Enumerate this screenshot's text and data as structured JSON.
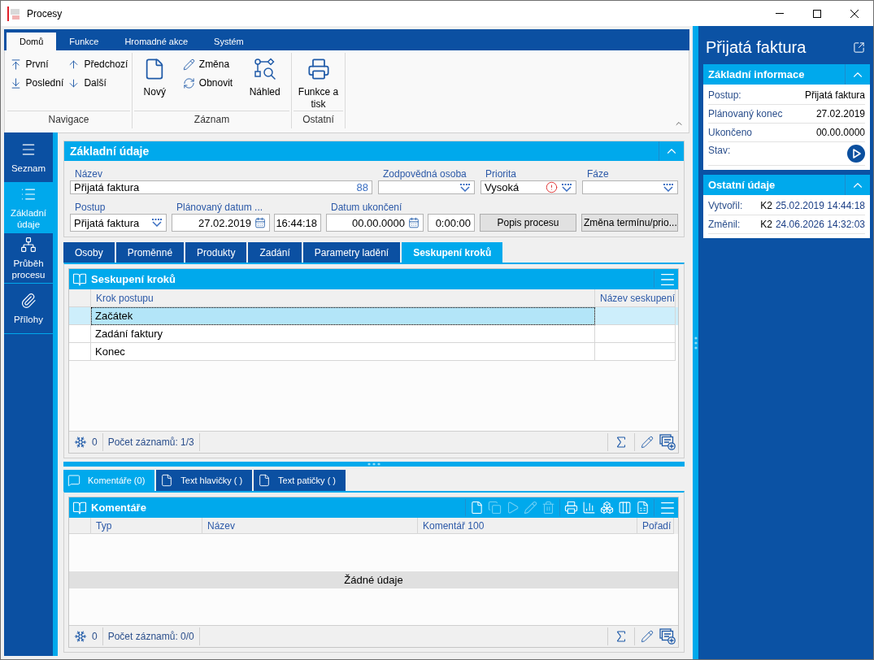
{
  "window": {
    "title": "Procesy"
  },
  "ribbon": {
    "tabs": [
      {
        "label": "Domů",
        "selected": true
      },
      {
        "label": "Funkce",
        "selected": false
      },
      {
        "label": "Hromadné akce",
        "selected": false
      },
      {
        "label": "Systém",
        "selected": false
      }
    ],
    "groups": [
      {
        "label": "Navigace",
        "items": [
          {
            "label": "První",
            "kind": "small"
          },
          {
            "label": "Poslední",
            "kind": "small"
          },
          {
            "label": "Předchozí",
            "kind": "small"
          },
          {
            "label": "Další",
            "kind": "small"
          }
        ]
      },
      {
        "label": "Záznam",
        "items": [
          {
            "label": "Nový",
            "kind": "large"
          },
          {
            "label": "Změna",
            "kind": "small"
          },
          {
            "label": "Obnovit",
            "kind": "small"
          },
          {
            "label": "Náhled",
            "kind": "large"
          }
        ]
      },
      {
        "label": "Ostatní",
        "items": [
          {
            "label": "Funkce a tisk",
            "kind": "large"
          }
        ]
      }
    ]
  },
  "sidebar": {
    "items": [
      {
        "label": "Seznam",
        "selected": false
      },
      {
        "label": "Základní údaje",
        "selected": true
      },
      {
        "label": "Průběh procesu",
        "selected": false
      },
      {
        "label": "Přílohy",
        "selected": false
      }
    ]
  },
  "form": {
    "title": "Základní údaje",
    "expanded": true,
    "fields": [
      {
        "kind": "text",
        "label": "Název",
        "value": "Přijatá faktura",
        "counter": "88"
      },
      {
        "kind": "dropdown",
        "label": "Zodpovědná osoba",
        "alert": false
      },
      {
        "kind": "dropdown",
        "label": "Priorita",
        "value": "Vysoká",
        "alert": true
      },
      {
        "kind": "dropdown",
        "label": "Fáze",
        "alert": false
      },
      {
        "kind": "dropdown",
        "label": "Postup",
        "value": "Přijatá faktura",
        "alert": false
      },
      {
        "kind": "datetime",
        "label": "Plánovaný datum ...",
        "date": "27.02.2019",
        "time": "16:44:18"
      },
      {
        "kind": "datetime",
        "label": "Datum ukončení",
        "date": "00.00.0000",
        "time": "0:00:00"
      },
      {
        "kind": "button",
        "label": "Popis procesu"
      },
      {
        "kind": "button",
        "label": "Změna termínu/prio..."
      }
    ]
  },
  "detail_tabs": [
    {
      "label": "Osoby",
      "selected": false
    },
    {
      "label": "Proměnné",
      "selected": false
    },
    {
      "label": "Produkty",
      "selected": false
    },
    {
      "label": "Zadání",
      "selected": false
    },
    {
      "label": "Parametry ladění",
      "selected": false
    },
    {
      "label": "Seskupení kroků",
      "selected": true
    }
  ],
  "steps_grid": {
    "title": "Seskupení kroků",
    "columns": [
      "Krok postupu",
      "Název seskupení"
    ],
    "rows": [
      {
        "step": "Začátek",
        "selected": true
      },
      {
        "step": "Zadání faktury",
        "selected": false
      },
      {
        "step": "Konec",
        "selected": false
      }
    ],
    "footer": {
      "filter_count": "0",
      "records": "Počet záznamů: 1/3"
    }
  },
  "bottom_tabs": [
    {
      "label": "Komentáře (0)",
      "selected": true
    },
    {
      "label": "Text hlavičky ( )",
      "selected": false
    },
    {
      "label": "Text patičky ( )",
      "selected": false
    }
  ],
  "comments_grid": {
    "title": "Komentáře",
    "toolbar": [
      {
        "disabled": false
      },
      {
        "disabled": true
      },
      {
        "disabled": true
      },
      {
        "disabled": true
      },
      {
        "disabled": true
      },
      {
        "disabled": false
      },
      {
        "disabled": false
      },
      {
        "disabled": false
      },
      {
        "disabled": false
      },
      {
        "disabled": false
      }
    ],
    "columns": [
      "Typ",
      "Název",
      "Komentář 100",
      "Pořadí"
    ],
    "empty_message": "Žádné údaje",
    "footer": {
      "filter_count": "0",
      "records": "Počet záznamů: 0/0"
    }
  },
  "info_panel": {
    "title": "Přijatá faktura",
    "cards": [
      {
        "title": "Základní informace",
        "expanded": true,
        "rows": [
          {
            "kind": "text",
            "label": "Postup:",
            "value": "Přijatá faktura"
          },
          {
            "kind": "text",
            "label": "Plánovaný konec",
            "value": "27.02.2019"
          },
          {
            "kind": "text",
            "label": "Ukončeno",
            "value": "00.00.0000"
          },
          {
            "kind": "status",
            "label": "Stav:"
          }
        ]
      },
      {
        "title": "Ostatní údaje",
        "expanded": true,
        "rows": [
          {
            "kind": "audit",
            "label": "Vytvořil:",
            "user": "K2",
            "value": "25.02.2019 14:44:18"
          },
          {
            "kind": "audit",
            "label": "Změnil:",
            "user": "K2",
            "value": "24.06.2026 14:32:03"
          }
        ]
      }
    ]
  }
}
